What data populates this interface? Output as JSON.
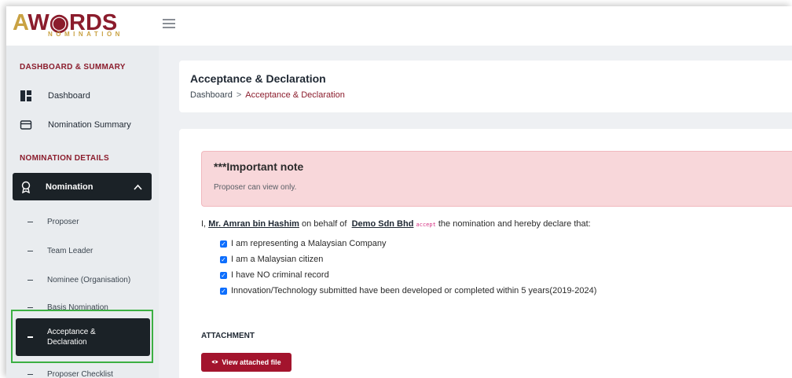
{
  "logo": {
    "main_a": "A",
    "main_rest": "W◉RDS",
    "sub": "NOMINATION"
  },
  "sidebar": {
    "section1": "DASHBOARD & SUMMARY",
    "dashboard": "Dashboard",
    "nomination_summary": "Nomination Summary",
    "section2": "NOMINATION DETAILS",
    "nomination": "Nomination",
    "sub_items": [
      "Proposer",
      "Team Leader",
      "Nominee (Organisation)",
      "Basis Nomination"
    ],
    "active_line1": "Acceptance &",
    "active_line2": "Declaration",
    "next_item": "Proposer Checklist"
  },
  "header": {
    "title": "Acceptance & Declaration",
    "breadcrumb_root": "Dashboard",
    "breadcrumb_sep": ">",
    "breadcrumb_current": "Acceptance & Declaration"
  },
  "alert": {
    "title": "***Important note",
    "text": "Proposer can view only."
  },
  "declaration": {
    "prefix": "I,",
    "person": "Mr. Amran bin Hashim",
    "behalf": "on behalf of",
    "company": "Demo Sdn Bhd",
    "tag": "accept",
    "suffix": "the nomination and hereby declare that:"
  },
  "checks": [
    "I am representing a Malaysian Company",
    "I am a Malaysian citizen",
    "I have NO criminal record",
    "Innovation/Technology submitted have been developed or completed within 5 years(2019-2024)"
  ],
  "attachment": {
    "title": "ATTACHMENT",
    "button": "View attached file"
  },
  "colors": {
    "brand": "#8b1c2c",
    "accent": "#c9a243",
    "dark": "#1b2227",
    "button": "#a3142d",
    "highlight": "#3cb043"
  }
}
